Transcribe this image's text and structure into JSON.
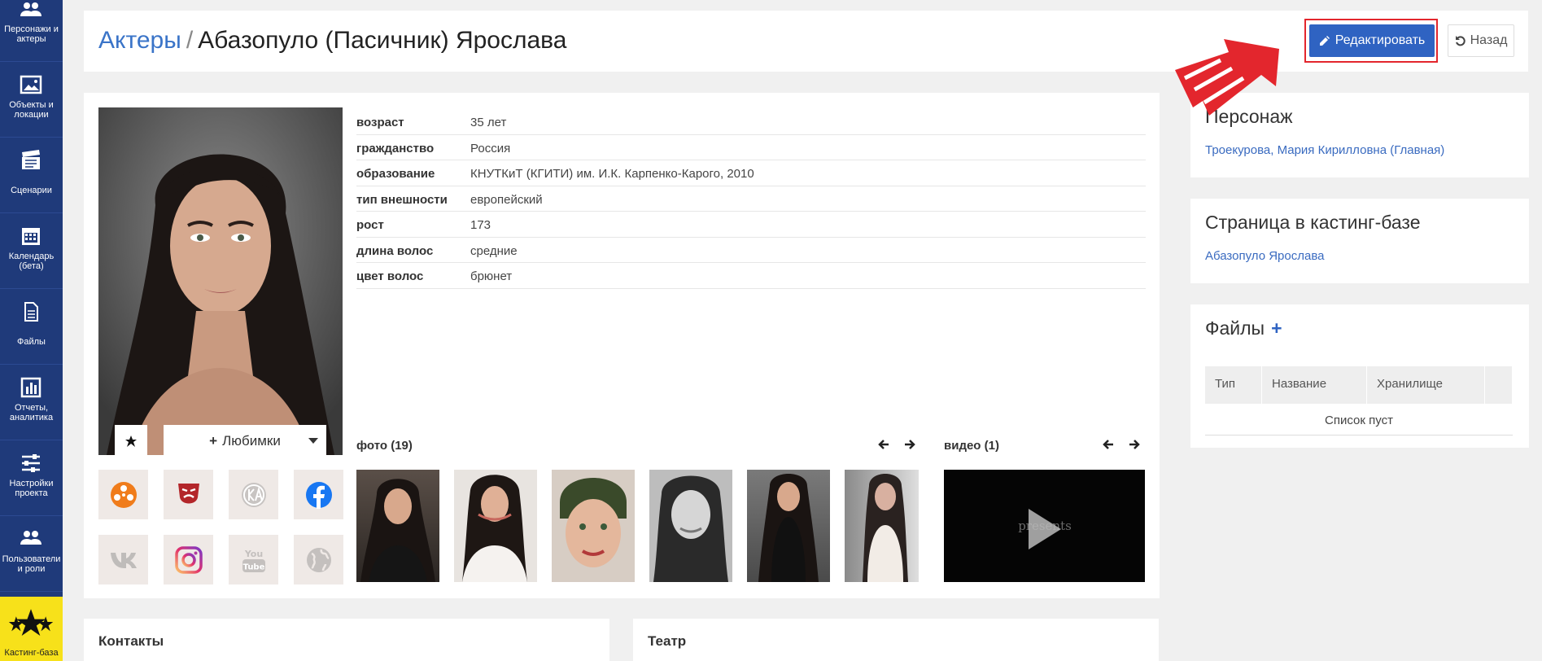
{
  "sidebar": {
    "items": [
      {
        "label": "Персонажи и актеры",
        "icon": "users-icon"
      },
      {
        "label": "Объекты и локации",
        "icon": "image-icon"
      },
      {
        "label": "Сценарии",
        "icon": "clapperboard-icon"
      },
      {
        "label": "Календарь (бета)",
        "icon": "calendar-icon"
      },
      {
        "label": "Файлы",
        "icon": "file-icon"
      },
      {
        "label": "Отчеты, аналитика",
        "icon": "bar-chart-icon"
      },
      {
        "label": "Настройки проекта",
        "icon": "sliders-icon"
      },
      {
        "label": "Пользователи и роли",
        "icon": "users-icon"
      },
      {
        "label": "Кастинг-база",
        "icon": "stars-icon"
      }
    ]
  },
  "header": {
    "breadcrumb_link": "Актеры",
    "separator": "/",
    "title": "Абазопуло (Пасичник) Ярослава",
    "edit_label": "Редактировать",
    "back_label": "Назад"
  },
  "profile": {
    "favorites_label": "Любимки",
    "fields": [
      {
        "key": "возраст",
        "value": "35 лет"
      },
      {
        "key": "гражданство",
        "value": "Россия"
      },
      {
        "key": "образование",
        "value": "КНУТКиТ (КГИТИ) им. И.К. Карпенко-Карого, 2010"
      },
      {
        "key": "тип внешности",
        "value": "европейский"
      },
      {
        "key": "рост",
        "value": "173"
      },
      {
        "key": "длина волос",
        "value": "средние"
      },
      {
        "key": "цвет волос",
        "value": "брюнет"
      }
    ],
    "photos_label": "фото (19)",
    "video_label": "видео (1)",
    "video_overlay": "presents",
    "socials": [
      "kinopoisk-icon",
      "theater-mask-icon",
      "kino-teatr-icon",
      "facebook-icon",
      "vk-icon",
      "instagram-icon",
      "youtube-icon",
      "globe-icon"
    ]
  },
  "character": {
    "title": "Персонаж",
    "link": "Троекурова, Мария Кирилловна (Главная)"
  },
  "casting_page": {
    "title": "Страница в кастинг-базе",
    "link": "Абазопуло Ярослава"
  },
  "files": {
    "title": "Файлы",
    "columns": [
      "Тип",
      "Название",
      "Хранилище"
    ],
    "empty": "Список пуст"
  },
  "bottom": {
    "contacts_title": "Контакты",
    "theater_title": "Театр"
  },
  "colors": {
    "sidebar": "#1f3a7a",
    "accent": "#2f63c2",
    "link": "#3a74c8",
    "highlight": "#e3262d",
    "casting": "#f7e11a"
  }
}
